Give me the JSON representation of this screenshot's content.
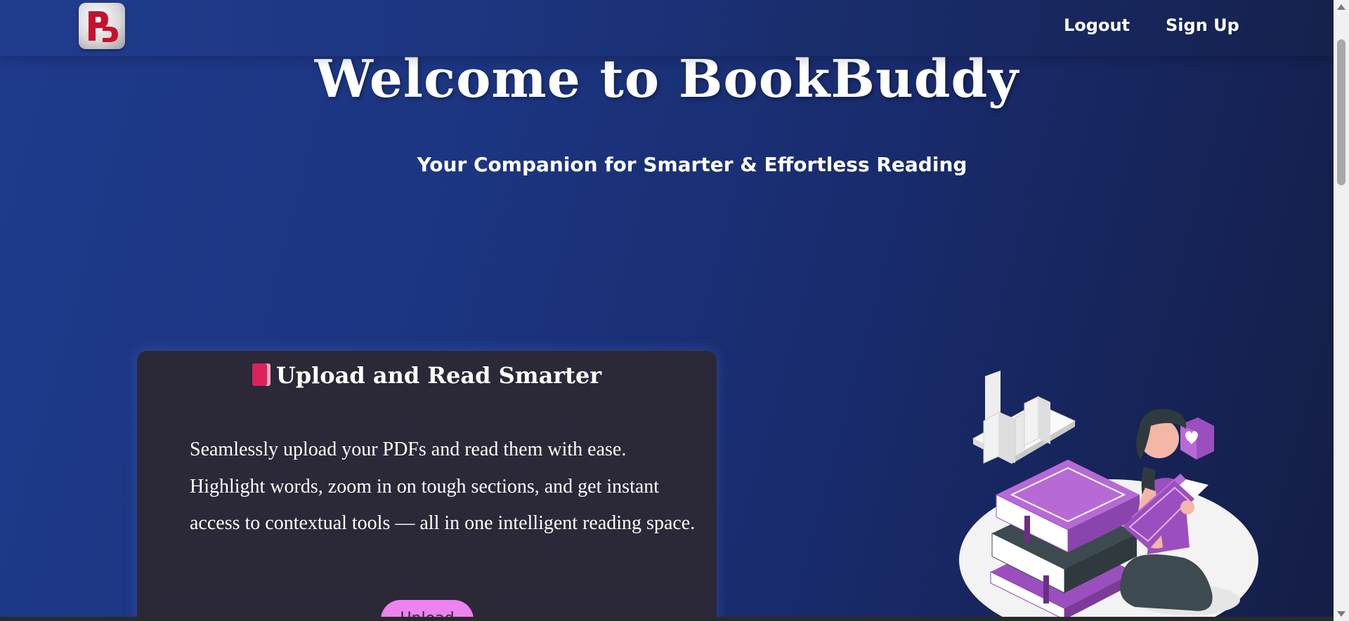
{
  "nav": {
    "logout_label": "Logout",
    "signup_label": "Sign Up",
    "logo_icon": "bookbuddy-logo"
  },
  "hero": {
    "title": "Welcome to BookBuddy",
    "subtitle": "Your Companion for Smarter & Effortless Reading"
  },
  "feature_card": {
    "icon": "red-book-emoji-icon",
    "title": "Upload and Read Smarter",
    "description": "Seamlessly upload your PDFs and read them with ease. Highlight words, zoom in on tough sections, and get instant access to contextual tools — all in one intelligent reading space.",
    "button_label": "Upload"
  },
  "illustration": {
    "icon": "woman-reading-books-illustration"
  },
  "colors": {
    "background_start": "#1f3a8c",
    "background_end": "#141d45",
    "card_background": "#2b2838",
    "button_background": "#ee82ee",
    "accent_purple": "#9b4fbf"
  }
}
